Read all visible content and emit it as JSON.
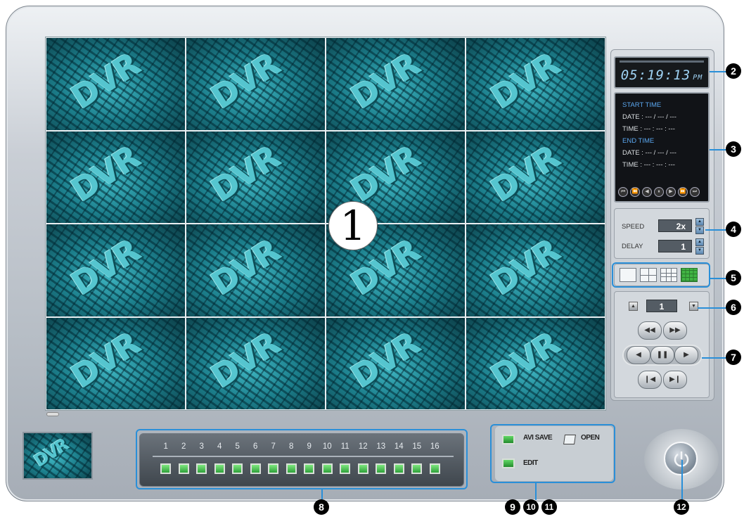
{
  "video_grid": {
    "watermark": "DVR",
    "tile_count": 16,
    "callout": "1"
  },
  "clock": {
    "time": "05:19:13",
    "ampm": "PM"
  },
  "search_info": {
    "start_header": "START TIME",
    "start_date": "DATE : --- / --- / ---",
    "start_time": "TIME : --- : --- : ---",
    "end_header": "END TIME",
    "end_date": "DATE : --- / --- / ---",
    "end_time": "TIME : --- : --- : ---"
  },
  "speed": {
    "label": "SPEED",
    "value": "2x"
  },
  "delay": {
    "label": "DELAY",
    "value": "1"
  },
  "channel_select": {
    "value": "1"
  },
  "channels": {
    "numbers": [
      "1",
      "2",
      "3",
      "4",
      "5",
      "6",
      "7",
      "8",
      "9",
      "10",
      "11",
      "12",
      "13",
      "14",
      "15",
      "16"
    ]
  },
  "file_ops": {
    "avi_save": "AVI SAVE",
    "open": "OPEN",
    "edit": "EDIT"
  },
  "callouts": {
    "c2": "2",
    "c3": "3",
    "c4": "4",
    "c5": "5",
    "c6": "6",
    "c7": "7",
    "c8": "8",
    "c9": "9",
    "c10": "10",
    "c11": "11",
    "c12": "12"
  },
  "colors": {
    "accent": "#2a8fd8",
    "led_green": "#3fbf48",
    "clock_text": "#9fd3f5",
    "info_header": "#5aa6ee"
  }
}
